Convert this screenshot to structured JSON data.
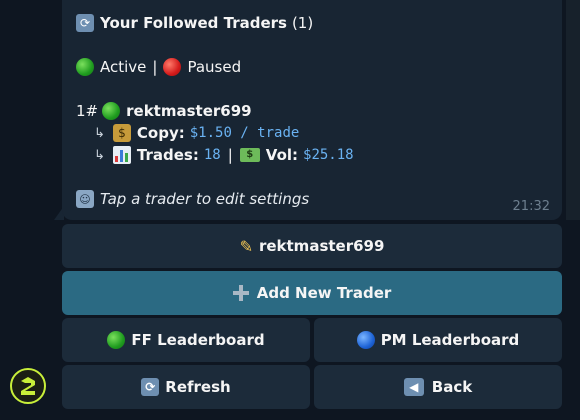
{
  "message": {
    "title": "Your Followed Traders",
    "count": "(1)",
    "legend_active": "Active",
    "legend_sep": "|",
    "legend_paused": "Paused",
    "trader_index": "1#",
    "trader_name": "rektmaster699",
    "arrow": "↳",
    "copy_label": "Copy:",
    "copy_value": "$1.50 / trade",
    "trades_label": "Trades:",
    "trades_value": "18",
    "stats_sep": "|",
    "vol_label": "Vol:",
    "vol_value": "$25.18",
    "hint": "Tap a trader to edit settings",
    "time": "21:32"
  },
  "keyboard": {
    "edit_trader": "rektmaster699",
    "add_trader": "Add New Trader",
    "ff_leaderboard": "FF Leaderboard",
    "pm_leaderboard": "PM Leaderboard",
    "refresh": "Refresh",
    "back": "Back"
  },
  "icons": {
    "refresh": "refresh-icon",
    "active": "green-circle-icon",
    "paused": "red-circle-icon",
    "money_bag": "money-bag-icon",
    "chart": "bar-chart-icon",
    "cash": "cash-icon",
    "hint": "user-badge-icon",
    "pencil": "pencil-icon",
    "plus": "plus-icon",
    "pm": "blue-circle-icon",
    "back": "back-arrow-icon",
    "logo": "bot-logo-icon"
  },
  "colors": {
    "background": "#0e1621",
    "bubble": "#182533",
    "button": "#1c2b3a",
    "primary_button": "#2b6a83",
    "mono_value": "#6ab2f2",
    "logo_accent": "#c8ef3a"
  }
}
